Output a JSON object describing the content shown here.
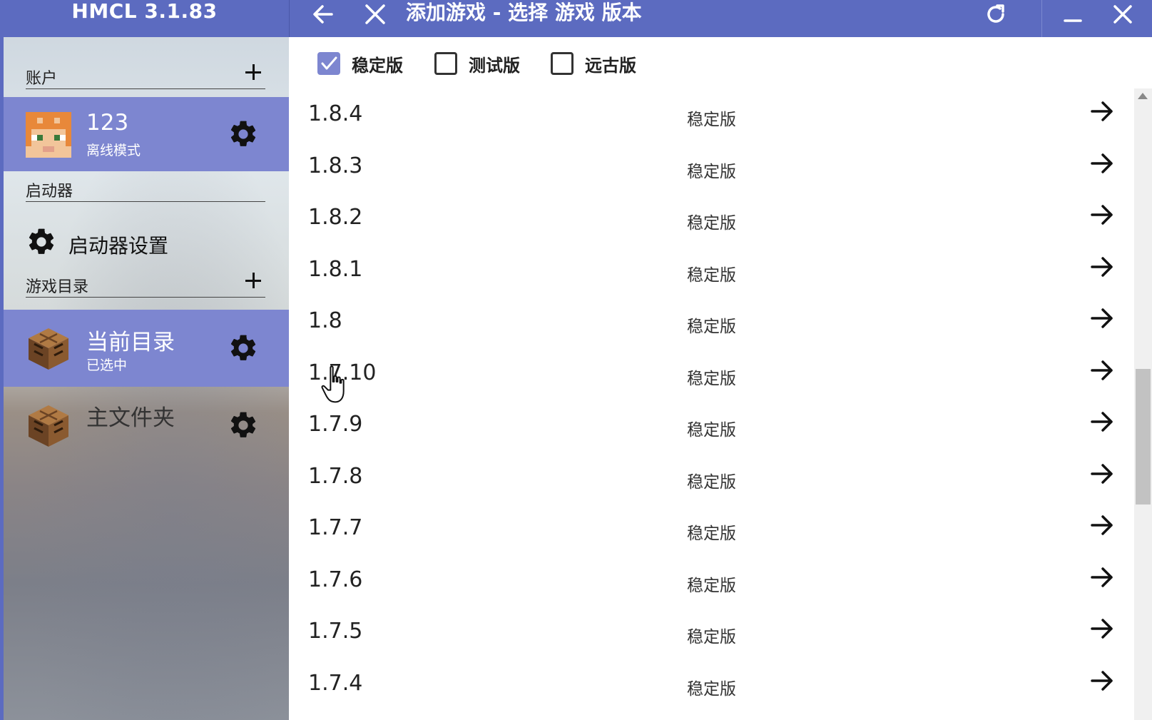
{
  "app": {
    "title": "HMCL 3.1.83"
  },
  "toolbar": {
    "page_title": "添加游戏 - 选择 游戏 版本"
  },
  "sidebar": {
    "account_header": "账户",
    "account": {
      "name": "123",
      "mode": "离线模式"
    },
    "launcher_header": "启动器",
    "launcher_settings": "启动器设置",
    "game_dir_header": "游戏目录",
    "directories": [
      {
        "name": "当前目录",
        "status": "已选中"
      },
      {
        "name": "主文件夹",
        "status": ""
      }
    ]
  },
  "filters": [
    {
      "label": "稳定版",
      "checked": true
    },
    {
      "label": "测试版",
      "checked": false
    },
    {
      "label": "远古版",
      "checked": false
    }
  ],
  "versions": [
    {
      "id": "1.8.4",
      "type": "稳定版"
    },
    {
      "id": "1.8.3",
      "type": "稳定版"
    },
    {
      "id": "1.8.2",
      "type": "稳定版"
    },
    {
      "id": "1.8.1",
      "type": "稳定版"
    },
    {
      "id": "1.8",
      "type": "稳定版"
    },
    {
      "id": "1.7.10",
      "type": "稳定版"
    },
    {
      "id": "1.7.9",
      "type": "稳定版"
    },
    {
      "id": "1.7.8",
      "type": "稳定版"
    },
    {
      "id": "1.7.7",
      "type": "稳定版"
    },
    {
      "id": "1.7.6",
      "type": "稳定版"
    },
    {
      "id": "1.7.5",
      "type": "稳定版"
    },
    {
      "id": "1.7.4",
      "type": "稳定版"
    }
  ],
  "scroll": {
    "position_fraction": 0.55,
    "visible_fraction": 0.22
  },
  "colors": {
    "accent": "#5c6bc0",
    "selected": "#7d86d0"
  }
}
